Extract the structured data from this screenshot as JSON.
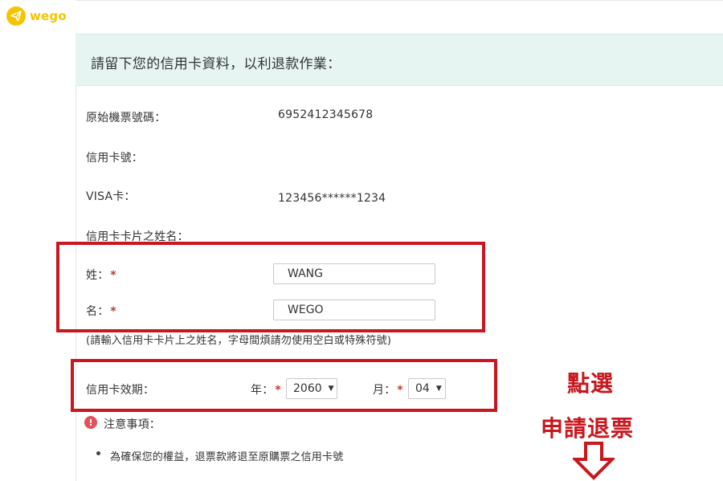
{
  "brand": {
    "name": "wego",
    "color": "#f5c400",
    "icon": "paper-plane-icon"
  },
  "panel": {
    "title": "請留下您的信用卡資料，以利退款作業：",
    "header_bg": "#e6f5f1"
  },
  "ticket": {
    "label": "原始機票號碼：",
    "value": "6952412345678"
  },
  "card": {
    "number_label": "信用卡號：",
    "type_label": "VISA卡：",
    "number_value": "123456******1234",
    "holder_label": "信用卡卡片之姓名："
  },
  "name": {
    "last_label": "姓：",
    "last_value": "WANG",
    "first_label": "名：",
    "first_value": "WEGO",
    "hint": "(請輸入信用卡卡片上之姓名，字母間煩請勿使用空白或特殊符號)"
  },
  "expiry": {
    "label": "信用卡效期：",
    "year_label": "年：",
    "year_value": "2060",
    "month_label": "月：",
    "month_value": "04"
  },
  "notes": {
    "title": "注意事項：",
    "items": [
      "為確保您的權益，退票款將退至原購票之信用卡號"
    ]
  },
  "annotation": {
    "line1": "點選",
    "line2": "申請退票",
    "arrow": "down-arrow-outline",
    "color": "#c8171e"
  },
  "required_mark": "*"
}
